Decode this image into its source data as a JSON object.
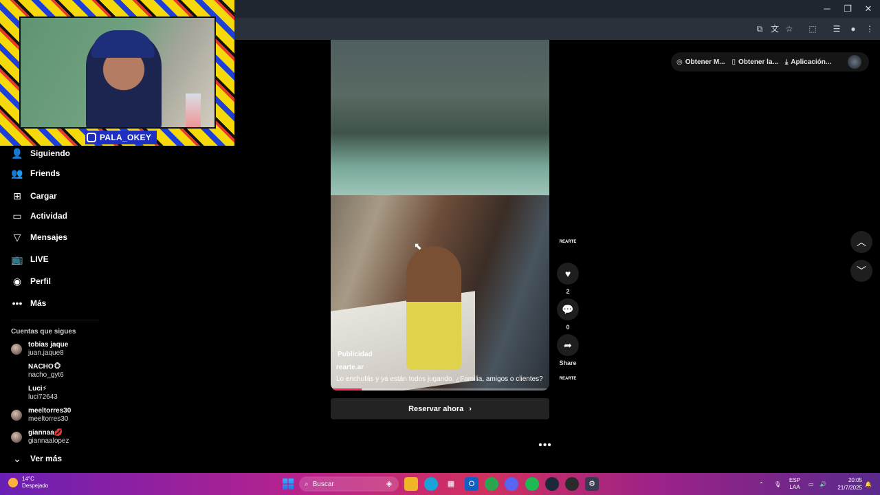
{
  "webcam": {
    "handle": "PALA_OKEY"
  },
  "sidebar": {
    "items": [
      {
        "label": "Siguiendo",
        "icon": "person-follow-icon"
      },
      {
        "label": "Friends",
        "icon": "friends-icon"
      },
      {
        "label": "Cargar",
        "icon": "upload-plus-icon"
      },
      {
        "label": "Actividad",
        "icon": "activity-icon"
      },
      {
        "label": "Mensajes",
        "icon": "messages-icon"
      },
      {
        "label": "LIVE",
        "icon": "live-tv-icon"
      },
      {
        "label": "Perfil",
        "icon": "profile-avatar-icon"
      },
      {
        "label": "Más",
        "icon": "more-dots-icon"
      }
    ],
    "following_title": "Cuentas que sigues",
    "accounts": [
      {
        "name": "tobias jaque",
        "handle": "juan.jaque8",
        "avatar": true
      },
      {
        "name": "NACHO🐵",
        "handle": "nacho_gyt6",
        "avatar": false
      },
      {
        "name": "Luci⚡",
        "handle": "luci72643",
        "avatar": false
      },
      {
        "name": "meeltorres30",
        "handle": "meeltorres30",
        "avatar": true
      },
      {
        "name": "giannaa💋",
        "handle": "giannaalopez",
        "avatar": true
      }
    ],
    "see_more": "Ver más"
  },
  "header_actions": {
    "get_coins": "Obtener M...",
    "get_app": "Obtener la...",
    "application": "Aplicación..."
  },
  "video": {
    "ad_label": "Publicidad",
    "username": "rearte.ar",
    "caption": "Lo enchufás y ya están todos jugando. ¿Familia, amigos o clientes?",
    "progress_fraction": 0.14,
    "cta_label": "Reservar ahora"
  },
  "actions": {
    "brand": "REARTE",
    "likes": "2",
    "comments": "0",
    "share_label": "Share"
  },
  "taskbar": {
    "temperature": "14°C",
    "weather": "Despejado",
    "search_placeholder": "Buscar",
    "lang_top": "ESP",
    "lang_bottom": "LAA",
    "time": "20:05",
    "date": "21/7/2025"
  },
  "colors": {
    "accent": "#fe2c55",
    "background": "#000000",
    "chrome_dark": "#1f2630"
  }
}
